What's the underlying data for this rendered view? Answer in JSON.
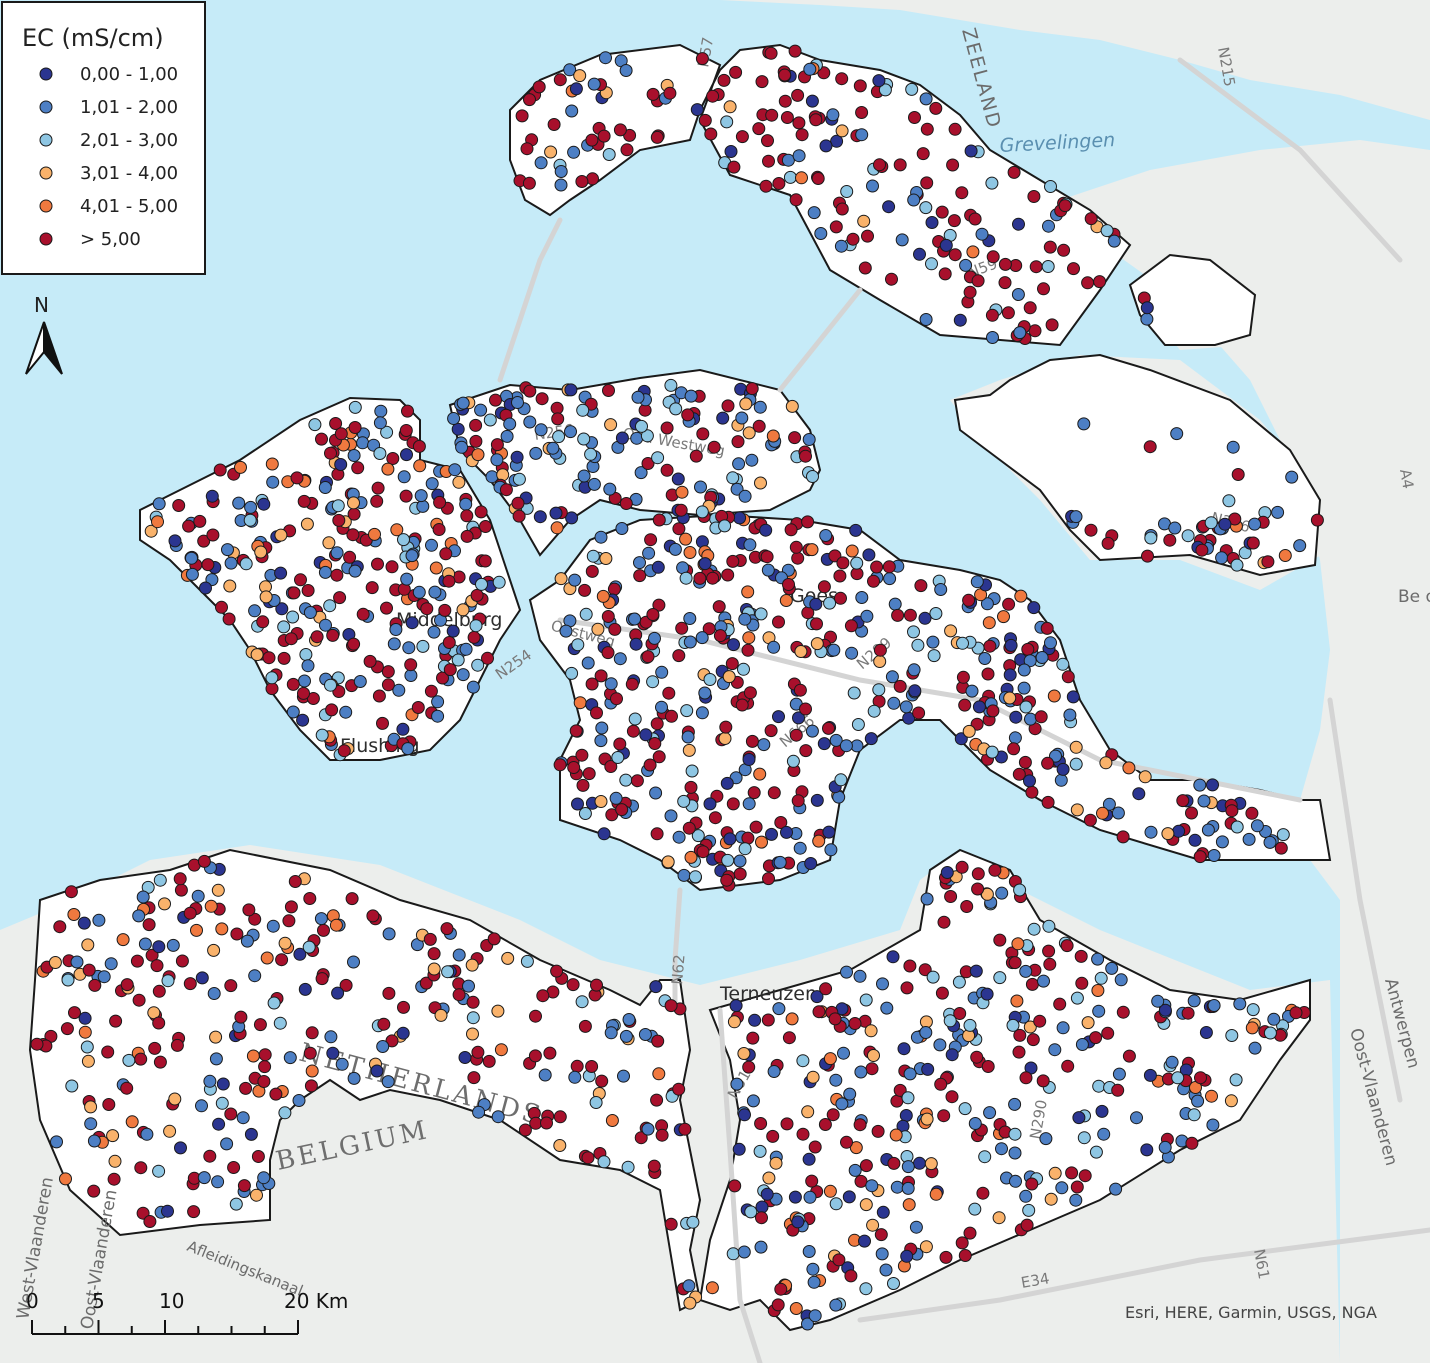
{
  "legend": {
    "title": "EC (mS/cm)",
    "classes": [
      {
        "label": "0,00 - 1,00",
        "color": "#2b3590"
      },
      {
        "label": "1,01 - 2,00",
        "color": "#4d7fc4"
      },
      {
        "label": "2,01 - 3,00",
        "color": "#8ec6e3"
      },
      {
        "label": "3,01 - 4,00",
        "color": "#f9b26b"
      },
      {
        "label": "4,01 - 5,00",
        "color": "#f0793f"
      },
      {
        "label": "> 5,00",
        "color": "#a8102c"
      }
    ]
  },
  "north_arrow": {
    "label": "N"
  },
  "scale_bar": {
    "ticks": [
      "0",
      "5",
      "10",
      "20 Km"
    ]
  },
  "attribution": "Esri, HERE, Garmin, USGS, NGA",
  "place_labels": {
    "zeeland": "ZEELAND",
    "grevelingen": "Grevelingen",
    "goes": "Goes",
    "middelburg": "Middelburg",
    "flushing": "Flushing",
    "terneuzen": "Terneuzen",
    "netherlands": "NETHERLANDS",
    "belgium": "BELGIUM",
    "west_vlaanderen": "West-Vlaanderen",
    "oost_vlaanderen_w": "Oost-Vlaanderen",
    "oost_vlaanderen_e": "Oost-Vlaanderen",
    "antwerpen": "Antwerpen",
    "afleidingskanaal": "Afleidingskanaal",
    "be_op": "Be op"
  },
  "road_labels": {
    "n57": "N57",
    "n215": "N215",
    "n59": "N59",
    "n256": "N256",
    "n286": "N286",
    "a4": "A4",
    "n254": "N254",
    "n666": "N666",
    "n289": "N289",
    "n62": "N62",
    "n61": "N61",
    "n290": "N290",
    "e34": "E34",
    "n61b": "N61",
    "oud_westweg": "Oud Westweg",
    "oostweg": "Oostweg"
  },
  "sample_clusters": [
    {
      "region": "Schouwen-Duiveland",
      "classes": [
        0,
        1,
        2,
        3,
        4,
        5
      ]
    },
    {
      "region": "Walcheren",
      "classes": [
        0,
        1,
        2,
        3,
        4,
        5
      ]
    },
    {
      "region": "Noord-Beveland",
      "classes": [
        0,
        1,
        2,
        3,
        5
      ]
    },
    {
      "region": "Zuid-Beveland",
      "classes": [
        0,
        1,
        2,
        3,
        4,
        5
      ]
    },
    {
      "region": "Tholen",
      "classes": [
        1,
        3,
        5
      ]
    },
    {
      "region": "Zeeuws-Vlaanderen West",
      "classes": [
        0,
        1,
        2,
        3,
        4,
        5
      ]
    },
    {
      "region": "Zeeuws-Vlaanderen Oost",
      "classes": [
        0,
        1,
        2,
        3,
        4,
        5
      ]
    }
  ]
}
